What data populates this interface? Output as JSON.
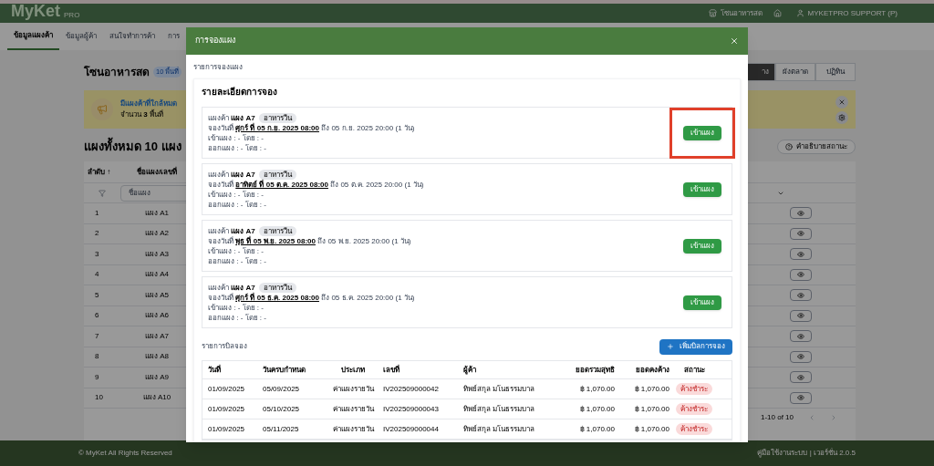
{
  "topbar": {
    "logo": "MyKet",
    "logo_sub": "PRO",
    "zone": "โซนอาหารสด",
    "user": "MYKETPRO SUPPORT (P)"
  },
  "nav_tabs": [
    {
      "label": "ข้อมูลแผงค้า",
      "selected": true
    },
    {
      "label": "ข้อมูลผู้ค้า",
      "selected": false
    },
    {
      "label": "สนใจทำการค้า",
      "selected": false
    },
    {
      "label": "การ",
      "selected": false
    }
  ],
  "page": {
    "title": "โซนอาหารสด",
    "badge": "10 พื้นที่",
    "view_buttons": [
      {
        "label": "าง",
        "selected": true
      },
      {
        "label": "ผังตลาด",
        "selected": false
      },
      {
        "label": "ปฏิทิน",
        "selected": false
      }
    ],
    "alert": {
      "title": "มีแผงค้าที่ใกล้หมด",
      "text": "จำนวน **3** พื้นที่"
    },
    "stalls_title": "แผงทั้งหมด 10 แผง",
    "legend_button": "คำอธิบายสถานะ",
    "table": {
      "columns": [
        "ลำดับ ↑",
        "ชื่อแผง/เลขที่"
      ],
      "filter_placeholder": "ชื่อแผง",
      "rows": [
        {
          "no": "1",
          "name": "แผง A1"
        },
        {
          "no": "2",
          "name": "แผง A2"
        },
        {
          "no": "3",
          "name": "แผง A3"
        },
        {
          "no": "4",
          "name": "แผง A4"
        },
        {
          "no": "5",
          "name": "แผง A5"
        },
        {
          "no": "6",
          "name": "แผง A6"
        },
        {
          "no": "7",
          "name": "แผง A7"
        },
        {
          "no": "8",
          "name": "แผง A8"
        },
        {
          "no": "9",
          "name": "แผง A9"
        },
        {
          "no": "10",
          "name": "แผง A10"
        }
      ]
    },
    "pagination": "1-10 of 10"
  },
  "footer": {
    "copyright": "© MyKet All Rights Reserved",
    "links": "คู่มือใช้งานระบบ | เวอร์ชั่น 2.0.5"
  },
  "modal": {
    "title": "การจองแผง",
    "section": "รายการจองแผง",
    "card_title": "รายละเอียดการจอง",
    "bookings": [
      {
        "stall_label": "แผงค้า",
        "stall": "แผง A7",
        "tag": "อาหารวีน",
        "date_label": "จองวันที่",
        "start": "ศุกร์ ที่ 05 ก.ย. 2025 08:00",
        "end": "ถึง 05 ก.ย. 2025 20:00 (1 วัน)",
        "check_in": "เข้าแผง : - โดย : -",
        "check_out": "ออกแผง : - โดย : -",
        "button": "เข้าแผง",
        "highlighted": true
      },
      {
        "stall_label": "แผงค้า",
        "stall": "แผง A7",
        "tag": "อาหารวีน",
        "date_label": "จองวันที่",
        "start": "อาทิตย์ ที่ 05 ต.ค. 2025 08:00",
        "end": "ถึง 05 ต.ค. 2025 20:00 (1 วัน)",
        "check_in": "เข้าแผง : - โดย : -",
        "check_out": "ออกแผง : - โดย : -",
        "button": "เข้าแผง",
        "highlighted": false
      },
      {
        "stall_label": "แผงค้า",
        "stall": "แผง A7",
        "tag": "อาหารวีน",
        "date_label": "จองวันที่",
        "start": "พุธ ที่ 05 พ.ย. 2025 08:00",
        "end": "ถึง 05 พ.ย. 2025 20:00 (1 วัน)",
        "check_in": "เข้าแผง : - โดย : -",
        "check_out": "ออกแผง : - โดย : -",
        "button": "เข้าแผง",
        "highlighted": false
      },
      {
        "stall_label": "แผงค้า",
        "stall": "แผง A7",
        "tag": "อาหารวีน",
        "date_label": "จองวันที่",
        "start": "ศุกร์ ที่ 05 ธ.ค. 2025 08:00",
        "end": "ถึง 05 ธ.ค. 2025 20:00 (1 วัน)",
        "check_in": "เข้าแผง : - โดย : -",
        "check_out": "ออกแผง : - โดย : -",
        "button": "เข้าแผง",
        "highlighted": false
      }
    ],
    "bills_title": "รายการบิลจอง",
    "add_button": "เพิ่มบิลการจอง",
    "bills": {
      "columns": [
        "วันที่",
        "วันครบกำหนด",
        "ประเภท",
        "เลขที่",
        "ผู้ค้า",
        "ยอดรวมสุทธิ",
        "ยอดคงค้าง",
        "สถานะ"
      ],
      "rows": [
        [
          "01/09/2025",
          "05/09/2025",
          "ค่าแผงรายวัน",
          "IV202509000042",
          "ทิพย์สกุล มโนธรรมบาล",
          "฿ 1,070.00",
          "฿ 1,070.00",
          "ค้างชำระ"
        ],
        [
          "01/09/2025",
          "05/10/2025",
          "ค่าแผงรายวัน",
          "IV202509000043",
          "ทิพย์สกุล มโนธรรมบาล",
          "฿ 1,070.00",
          "฿ 1,070.00",
          "ค้างชำระ"
        ],
        [
          "01/09/2025",
          "05/11/2025",
          "ค่าแผงรายวัน",
          "IV202509000044",
          "ทิพย์สกุล มโนธรรมบาล",
          "฿ 1,070.00",
          "฿ 1,070.00",
          "ค้างชำระ"
        ]
      ]
    }
  }
}
